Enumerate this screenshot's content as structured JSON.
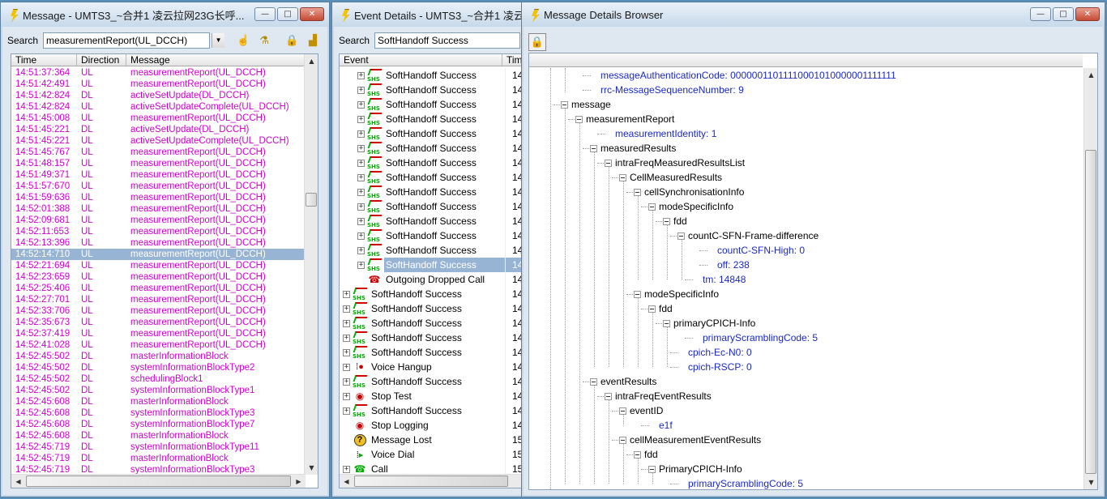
{
  "win1": {
    "title": "Message - UMTS3_~合并1 凌云拉网23G长呼...",
    "search_label": "Search",
    "search_value": "measurementReport(UL_DCCH)",
    "columns": [
      "Time",
      "Direction",
      "Message"
    ],
    "rows": [
      {
        "time": "14:51:37:364",
        "dir": "UL",
        "msg": "measurementReport(UL_DCCH)"
      },
      {
        "time": "14:51:42:491",
        "dir": "UL",
        "msg": "measurementReport(UL_DCCH)"
      },
      {
        "time": "14:51:42:824",
        "dir": "DL",
        "msg": "activeSetUpdate(DL_DCCH)"
      },
      {
        "time": "14:51:42:824",
        "dir": "UL",
        "msg": "activeSetUpdateComplete(UL_DCCH)"
      },
      {
        "time": "14:51:45:008",
        "dir": "UL",
        "msg": "measurementReport(UL_DCCH)"
      },
      {
        "time": "14:51:45:221",
        "dir": "DL",
        "msg": "activeSetUpdate(DL_DCCH)"
      },
      {
        "time": "14:51:45:221",
        "dir": "UL",
        "msg": "activeSetUpdateComplete(UL_DCCH)"
      },
      {
        "time": "14:51:45:767",
        "dir": "UL",
        "msg": "measurementReport(UL_DCCH)"
      },
      {
        "time": "14:51:48:157",
        "dir": "UL",
        "msg": "measurementReport(UL_DCCH)"
      },
      {
        "time": "14:51:49:371",
        "dir": "UL",
        "msg": "measurementReport(UL_DCCH)"
      },
      {
        "time": "14:51:57:670",
        "dir": "UL",
        "msg": "measurementReport(UL_DCCH)"
      },
      {
        "time": "14:51:59:636",
        "dir": "UL",
        "msg": "measurementReport(UL_DCCH)"
      },
      {
        "time": "14:52:01:388",
        "dir": "UL",
        "msg": "measurementReport(UL_DCCH)"
      },
      {
        "time": "14:52:09:681",
        "dir": "UL",
        "msg": "measurementReport(UL_DCCH)"
      },
      {
        "time": "14:52:11:653",
        "dir": "UL",
        "msg": "measurementReport(UL_DCCH)"
      },
      {
        "time": "14:52:13:396",
        "dir": "UL",
        "msg": "measurementReport(UL_DCCH)"
      },
      {
        "time": "14:52:14:710",
        "dir": "UL",
        "msg": "measurementReport(UL_DCCH)",
        "selected": true
      },
      {
        "time": "14:52:21:694",
        "dir": "UL",
        "msg": "measurementReport(UL_DCCH)"
      },
      {
        "time": "14:52:23:659",
        "dir": "UL",
        "msg": "measurementReport(UL_DCCH)"
      },
      {
        "time": "14:52:25:406",
        "dir": "UL",
        "msg": "measurementReport(UL_DCCH)"
      },
      {
        "time": "14:52:27:701",
        "dir": "UL",
        "msg": "measurementReport(UL_DCCH)"
      },
      {
        "time": "14:52:33:706",
        "dir": "UL",
        "msg": "measurementReport(UL_DCCH)"
      },
      {
        "time": "14:52:35:673",
        "dir": "UL",
        "msg": "measurementReport(UL_DCCH)"
      },
      {
        "time": "14:52:37:419",
        "dir": "UL",
        "msg": "measurementReport(UL_DCCH)"
      },
      {
        "time": "14:52:41:028",
        "dir": "UL",
        "msg": "measurementReport(UL_DCCH)"
      },
      {
        "time": "14:52:45:502",
        "dir": "DL",
        "msg": "masterInformationBlock"
      },
      {
        "time": "14:52:45:502",
        "dir": "DL",
        "msg": "systemInformationBlockType2"
      },
      {
        "time": "14:52:45:502",
        "dir": "DL",
        "msg": "schedulingBlock1"
      },
      {
        "time": "14:52:45:502",
        "dir": "DL",
        "msg": "systemInformationBlockType1"
      },
      {
        "time": "14:52:45:608",
        "dir": "DL",
        "msg": "masterInformationBlock"
      },
      {
        "time": "14:52:45:608",
        "dir": "DL",
        "msg": "systemInformationBlockType3"
      },
      {
        "time": "14:52:45:608",
        "dir": "DL",
        "msg": "systemInformationBlockType7"
      },
      {
        "time": "14:52:45:608",
        "dir": "DL",
        "msg": "masterInformationBlock"
      },
      {
        "time": "14:52:45:719",
        "dir": "DL",
        "msg": "systemInformationBlockType11"
      },
      {
        "time": "14:52:45:719",
        "dir": "DL",
        "msg": "masterInformationBlock"
      },
      {
        "time": "14:52:45:719",
        "dir": "DL",
        "msg": "systemInformationBlockType3"
      }
    ]
  },
  "win2": {
    "title": "Event Details - UMTS3_~合并1 凌云",
    "search_label": "Search",
    "search_value": "SoftHandoff Success",
    "columns": [
      "Event",
      "Tim"
    ],
    "rows": [
      {
        "label": "SoftHandoff Success",
        "time": "14:",
        "icon": "soft-handoff-icon",
        "indent": 1,
        "expand": true
      },
      {
        "label": "SoftHandoff Success",
        "time": "14:",
        "icon": "soft-handoff-icon",
        "indent": 1,
        "expand": true
      },
      {
        "label": "SoftHandoff Success",
        "time": "14:",
        "icon": "soft-handoff-icon",
        "indent": 1,
        "expand": true
      },
      {
        "label": "SoftHandoff Success",
        "time": "14:",
        "icon": "soft-handoff-icon",
        "indent": 1,
        "expand": true
      },
      {
        "label": "SoftHandoff Success",
        "time": "14:",
        "icon": "soft-handoff-icon",
        "indent": 1,
        "expand": true
      },
      {
        "label": "SoftHandoff Success",
        "time": "14:",
        "icon": "soft-handoff-icon",
        "indent": 1,
        "expand": true
      },
      {
        "label": "SoftHandoff Success",
        "time": "14:",
        "icon": "soft-handoff-icon",
        "indent": 1,
        "expand": true
      },
      {
        "label": "SoftHandoff Success",
        "time": "14:",
        "icon": "soft-handoff-icon",
        "indent": 1,
        "expand": true
      },
      {
        "label": "SoftHandoff Success",
        "time": "14:",
        "icon": "soft-handoff-icon",
        "indent": 1,
        "expand": true
      },
      {
        "label": "SoftHandoff Success",
        "time": "14:",
        "icon": "soft-handoff-icon",
        "indent": 1,
        "expand": true
      },
      {
        "label": "SoftHandoff Success",
        "time": "14:",
        "icon": "soft-handoff-icon",
        "indent": 1,
        "expand": true
      },
      {
        "label": "SoftHandoff Success",
        "time": "14:",
        "icon": "soft-handoff-icon",
        "indent": 1,
        "expand": true
      },
      {
        "label": "SoftHandoff Success",
        "time": "14:",
        "icon": "soft-handoff-icon",
        "indent": 1,
        "expand": true
      },
      {
        "label": "SoftHandoff Success",
        "time": "14:",
        "icon": "soft-handoff-icon",
        "indent": 1,
        "expand": true,
        "selected": true
      },
      {
        "label": "Outgoing Dropped Call",
        "time": "14:",
        "icon": "dropped-call-icon",
        "indent": 1,
        "expand": false
      },
      {
        "label": "SoftHandoff Success",
        "time": "14:",
        "icon": "soft-handoff-icon",
        "indent": 0,
        "expand": true
      },
      {
        "label": "SoftHandoff Success",
        "time": "14:",
        "icon": "soft-handoff-icon",
        "indent": 0,
        "expand": true
      },
      {
        "label": "SoftHandoff Success",
        "time": "14:",
        "icon": "soft-handoff-icon",
        "indent": 0,
        "expand": true
      },
      {
        "label": "SoftHandoff Success",
        "time": "14:",
        "icon": "soft-handoff-icon",
        "indent": 0,
        "expand": true
      },
      {
        "label": "SoftHandoff Success",
        "time": "14:",
        "icon": "soft-handoff-icon",
        "indent": 0,
        "expand": true
      },
      {
        "label": "Voice Hangup",
        "time": "14:",
        "icon": "voice-hangup-icon",
        "indent": 0,
        "expand": true
      },
      {
        "label": "SoftHandoff Success",
        "time": "14:",
        "icon": "soft-handoff-icon",
        "indent": 0,
        "expand": true
      },
      {
        "label": "Stop Test",
        "time": "14:",
        "icon": "stop-test-icon",
        "indent": 0,
        "expand": true
      },
      {
        "label": "SoftHandoff Success",
        "time": "14:",
        "icon": "soft-handoff-icon",
        "indent": 0,
        "expand": true
      },
      {
        "label": "Stop Logging",
        "time": "14:",
        "icon": "stop-logging-icon",
        "indent": 0,
        "expand": false
      },
      {
        "label": "Message Lost",
        "time": "15:",
        "icon": "message-lost-icon",
        "indent": 0,
        "expand": false
      },
      {
        "label": "Voice Dial",
        "time": "15:",
        "icon": "voice-dial-icon",
        "indent": 0,
        "expand": false
      },
      {
        "label": "Call",
        "time": "15:",
        "icon": "call-icon",
        "indent": 0,
        "expand": true
      }
    ]
  },
  "win3": {
    "title": "Message Details Browser",
    "tree": [
      {
        "d": 4,
        "t": "messageAuthenticationCode: 00000011011110001010000001111111",
        "leaf": true
      },
      {
        "d": 4,
        "t": "rrc-MessageSequenceNumber: 9",
        "leaf": true
      },
      {
        "d": 2,
        "t": "message",
        "leaf": false
      },
      {
        "d": 3,
        "t": "measurementReport",
        "leaf": false
      },
      {
        "d": 5,
        "t": "measurementIdentity: 1",
        "leaf": true
      },
      {
        "d": 4,
        "t": "measuredResults",
        "leaf": false
      },
      {
        "d": 5,
        "t": "intraFreqMeasuredResultsList",
        "leaf": false
      },
      {
        "d": 6,
        "t": "CellMeasuredResults",
        "leaf": false
      },
      {
        "d": 7,
        "t": "cellSynchronisationInfo",
        "leaf": false
      },
      {
        "d": 8,
        "t": "modeSpecificInfo",
        "leaf": false
      },
      {
        "d": 9,
        "t": "fdd",
        "leaf": false
      },
      {
        "d": 10,
        "t": "countC-SFN-Frame-difference",
        "leaf": false
      },
      {
        "d": 12,
        "t": "countC-SFN-High: 0",
        "leaf": true
      },
      {
        "d": 12,
        "t": "off: 238",
        "leaf": true
      },
      {
        "d": 11,
        "t": "tm: 14848",
        "leaf": true
      },
      {
        "d": 7,
        "t": "modeSpecificInfo",
        "leaf": false
      },
      {
        "d": 8,
        "t": "fdd",
        "leaf": false
      },
      {
        "d": 9,
        "t": "primaryCPICH-Info",
        "leaf": false
      },
      {
        "d": 11,
        "t": "primaryScramblingCode: 5",
        "leaf": true
      },
      {
        "d": 10,
        "t": "cpich-Ec-N0: 0",
        "leaf": true
      },
      {
        "d": 10,
        "t": "cpich-RSCP: 0",
        "leaf": true
      },
      {
        "d": 4,
        "t": "eventResults",
        "leaf": false
      },
      {
        "d": 5,
        "t": "intraFreqEventResults",
        "leaf": false
      },
      {
        "d": 6,
        "t": "eventID",
        "leaf": false
      },
      {
        "d": 8,
        "t": "e1f",
        "leaf": true
      },
      {
        "d": 6,
        "t": "cellMeasurementEventResults",
        "leaf": false
      },
      {
        "d": 7,
        "t": "fdd",
        "leaf": false
      },
      {
        "d": 8,
        "t": "PrimaryCPICH-Info",
        "leaf": false
      },
      {
        "d": 10,
        "t": "primaryScramblingCode: 5",
        "leaf": true
      }
    ]
  },
  "controls": {
    "minimize": "—",
    "maximize": "□",
    "close": "✕"
  }
}
